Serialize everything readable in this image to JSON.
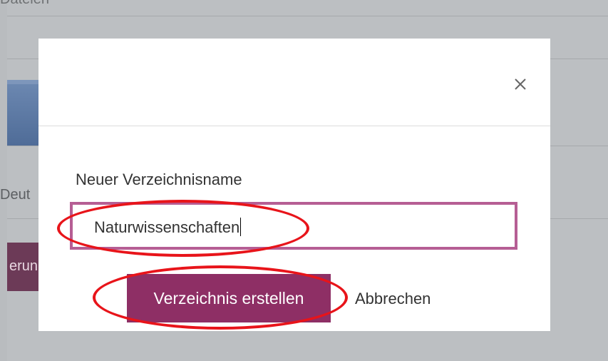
{
  "background": {
    "top_text": "Dateien",
    "side_text": "Deut",
    "button_fragment": "erun"
  },
  "dialog": {
    "close_icon": "close-icon",
    "field_label": "Neuer Verzeichnisname",
    "input_value": "Naturwissenschaften",
    "primary_button": "Verzeichnis erstellen",
    "cancel_link": "Abbrechen"
  },
  "colors": {
    "accent": "#8e2f65",
    "input_border": "#b65e94",
    "annotation": "#e8141a"
  }
}
